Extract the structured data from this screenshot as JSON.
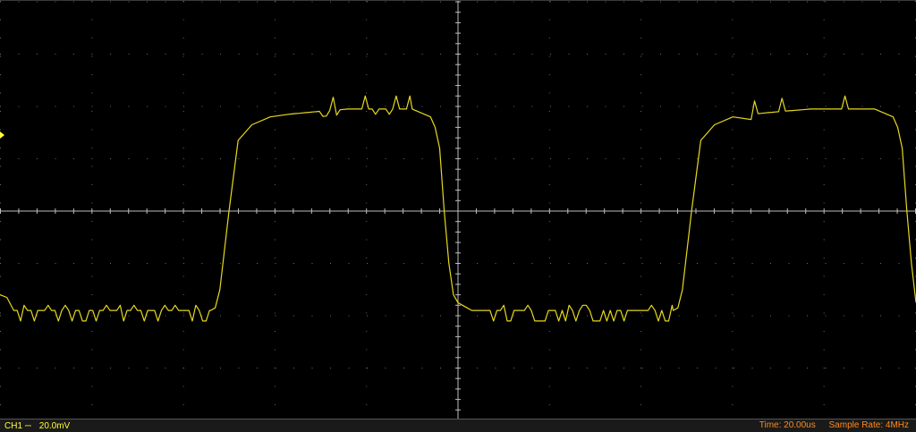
{
  "channel": {
    "label": "CH1",
    "coupling_icon": "dc-coupling-icon",
    "coupling_glyph": "⎓",
    "scale": "20.0mV",
    "trace_color": "#e6d81e",
    "marker_color": "#ffff33"
  },
  "timebase": {
    "time_text": "Time: 20.00us",
    "sample_rate_text": "Sample Rate: 4MHz",
    "text_color": "#ff8a1a"
  },
  "chart_data": {
    "type": "line",
    "title": "",
    "xlabel": "",
    "ylabel": "",
    "x_unit": "us",
    "y_unit": "mV",
    "xlim": [
      0,
      200
    ],
    "ylim": [
      -80,
      80
    ],
    "grid": true,
    "series": [
      {
        "x": [
          0,
          1.5,
          3,
          46,
          47,
          48,
          50,
          52,
          55,
          59,
          63,
          69,
          76,
          90,
          94,
          95,
          96,
          97,
          98,
          99,
          100,
          101,
          102,
          103,
          104,
          147,
          148,
          149,
          151,
          153,
          156,
          160,
          164,
          170,
          177,
          191,
          195,
          196,
          197,
          198,
          199,
          200
        ],
        "y": [
          -32,
          -33,
          -38,
          -38,
          -37,
          -30,
          0,
          27,
          33,
          36,
          37,
          38,
          39,
          39,
          36,
          32,
          24,
          0,
          -20,
          -32,
          -35,
          -36,
          -37,
          -38,
          -38,
          -38,
          -37,
          -30,
          0,
          27,
          33,
          36,
          37,
          38,
          39,
          39,
          36,
          32,
          24,
          0,
          -20,
          -35
        ]
      }
    ]
  }
}
